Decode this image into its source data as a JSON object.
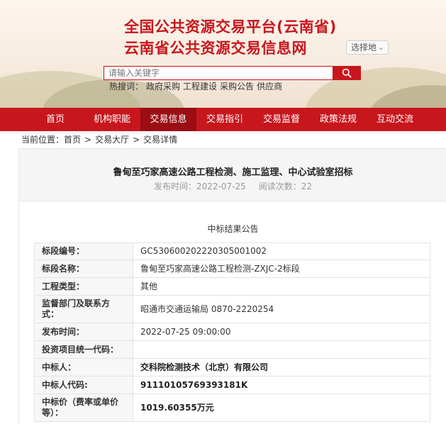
{
  "header": {
    "title_line1": "全国公共资源交易平台(云南省)",
    "title_line2": "云南省公共资源交易信息网",
    "region_label": "选择地",
    "search": {
      "placeholder": "请输入关键字"
    },
    "hot_label": "热搜词：",
    "hot_words": [
      "政府采购",
      "工程建设",
      "采购公告",
      "供应商"
    ]
  },
  "nav": {
    "items": [
      "首页",
      "机构职能",
      "交易信息",
      "交易指引",
      "交易监督",
      "政策法规",
      "互动交流"
    ],
    "active_index": 2
  },
  "breadcrumb": {
    "prefix": "当前位置：",
    "items": [
      "首页",
      ">",
      "交易大厅",
      ">",
      "交易详情"
    ]
  },
  "article": {
    "title": "鲁甸至巧家高速公路工程检测、施工监理、中心试验室招标",
    "publish_label": "发布时间：2022-07-25",
    "views_label": "阅读次数：22",
    "section_title": "中标结果公告"
  },
  "table": {
    "rows": [
      {
        "key": "标段编号：",
        "value": "GC530600202220305001002",
        "bold": false
      },
      {
        "key": "标段名称：",
        "value": "鲁甸至巧家高速公路工程检测-ZXJC-2标段",
        "bold": false
      },
      {
        "key": "工程类型：",
        "value": "其他",
        "bold": false
      },
      {
        "key": "监督部门及联系方式：",
        "value": "昭通市交通运输局 0870-2220254",
        "bold": false
      },
      {
        "key": "发布时间：",
        "value": "2022-07-25 09:00:00",
        "bold": false
      },
      {
        "key": "投资项目统一代码：",
        "value": "",
        "bold": false
      },
      {
        "key": "中标人：",
        "value": "交科院检测技术（北京）有限公司",
        "bold": true
      },
      {
        "key": "中标人代码:",
        "value": "91110105769393181K",
        "bold": true
      },
      {
        "key": "中标价（费率或单价等）：",
        "value": "1019.60355万元",
        "bold": true
      }
    ]
  },
  "colors": {
    "brand_red": "#c8161d",
    "nav_active": "#9b0e14"
  }
}
